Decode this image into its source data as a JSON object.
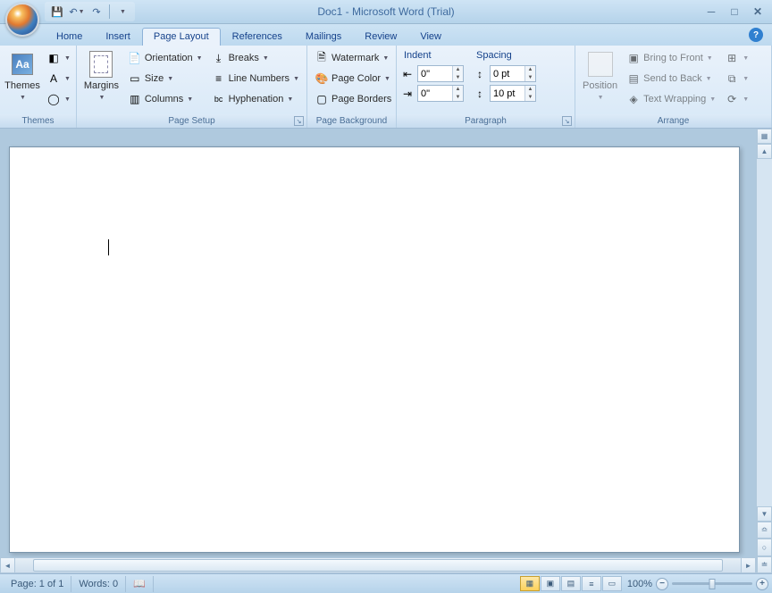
{
  "title": "Doc1 - Microsoft Word (Trial)",
  "tabs": {
    "home": "Home",
    "insert": "Insert",
    "page_layout": "Page Layout",
    "references": "References",
    "mailings": "Mailings",
    "review": "Review",
    "view": "View"
  },
  "ribbon": {
    "themes": {
      "label": "Themes",
      "themes_btn": "Themes"
    },
    "page_setup": {
      "label": "Page Setup",
      "margins": "Margins",
      "orientation": "Orientation",
      "size": "Size",
      "columns": "Columns",
      "breaks": "Breaks",
      "line_numbers": "Line Numbers",
      "hyphenation": "Hyphenation"
    },
    "page_background": {
      "label": "Page Background",
      "watermark": "Watermark",
      "page_color": "Page Color",
      "page_borders": "Page Borders"
    },
    "paragraph": {
      "label": "Paragraph",
      "indent": "Indent",
      "spacing": "Spacing",
      "indent_left": "0\"",
      "indent_right": "0\"",
      "spacing_before": "0 pt",
      "spacing_after": "10 pt"
    },
    "arrange": {
      "label": "Arrange",
      "position": "Position",
      "bring_front": "Bring to Front",
      "send_back": "Send to Back",
      "text_wrapping": "Text Wrapping"
    }
  },
  "statusbar": {
    "page": "Page: 1 of 1",
    "words": "Words: 0",
    "zoom": "100%"
  }
}
